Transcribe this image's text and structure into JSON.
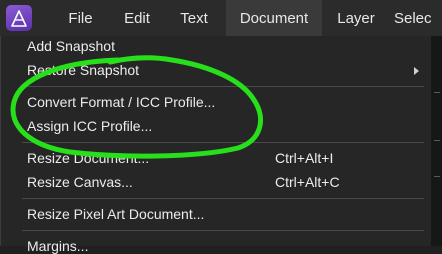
{
  "menubar": {
    "items": [
      {
        "label": "File"
      },
      {
        "label": "Edit"
      },
      {
        "label": "Text"
      },
      {
        "label": "Document",
        "active": true
      },
      {
        "label": "Layer"
      },
      {
        "label": "Selec"
      }
    ]
  },
  "dropdown": {
    "items": [
      {
        "label": "Add Snapshot"
      },
      {
        "label": "Restore Snapshot",
        "submenu": true
      },
      {
        "label": "Convert Format / ICC Profile..."
      },
      {
        "label": "Assign ICC Profile..."
      },
      {
        "label": "Resize Document...",
        "shortcut": "Ctrl+Alt+I"
      },
      {
        "label": "Resize Canvas...",
        "shortcut": "Ctrl+Alt+C"
      },
      {
        "label": "Resize Pixel Art Document..."
      },
      {
        "label": "Margins..."
      }
    ]
  },
  "colors": {
    "menubar_bg": "#2b2b2b",
    "menu_bg": "#262626",
    "active_tab_bg": "#3a3a3a",
    "highlight_ring": "#27e01b",
    "logo": "#7a4bc8"
  },
  "icons": {
    "app_logo": "affinity-photo-logo-icon",
    "submenu_arrow": "chevron-right-icon"
  }
}
